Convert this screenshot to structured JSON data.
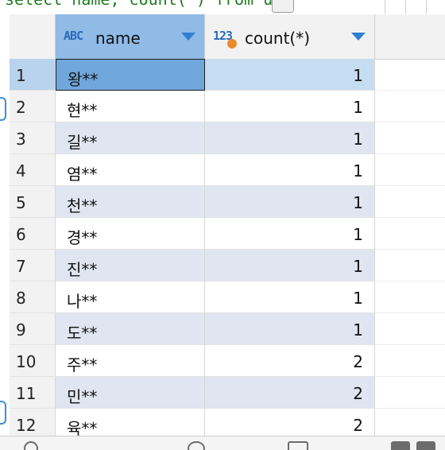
{
  "editor": {
    "sql_text": "select name, count(*) from ust"
  },
  "grid": {
    "columns": [
      {
        "type_badge": "ABC",
        "label": "name"
      },
      {
        "type_badge": "123",
        "label": "count(*)"
      }
    ],
    "rows": [
      {
        "num": "1",
        "name": "왕**",
        "count": "1"
      },
      {
        "num": "2",
        "name": "현**",
        "count": "1"
      },
      {
        "num": "3",
        "name": "길**",
        "count": "1"
      },
      {
        "num": "4",
        "name": "염**",
        "count": "1"
      },
      {
        "num": "5",
        "name": "천**",
        "count": "1"
      },
      {
        "num": "6",
        "name": "경**",
        "count": "1"
      },
      {
        "num": "7",
        "name": "진**",
        "count": "1"
      },
      {
        "num": "8",
        "name": "나**",
        "count": "1"
      },
      {
        "num": "9",
        "name": "도**",
        "count": "1"
      },
      {
        "num": "10",
        "name": "주**",
        "count": "2"
      },
      {
        "num": "11",
        "name": "민**",
        "count": "2"
      },
      {
        "num": "12",
        "name": "육**",
        "count": "2"
      }
    ],
    "selected_row": 1
  },
  "colors": {
    "header_selected": "#8fbbe6",
    "row_alt": "#dfe6f1",
    "selected_cell": "#6fa6dc",
    "type_badge": "#2c6bb8",
    "key_dot": "#e98a2b",
    "sql_text": "#1f7a1f"
  },
  "icons": {
    "sort": "chevron-down-icon",
    "text_type": "abc-type-icon",
    "number_type": "123-type-icon",
    "key": "key-dot-icon"
  }
}
